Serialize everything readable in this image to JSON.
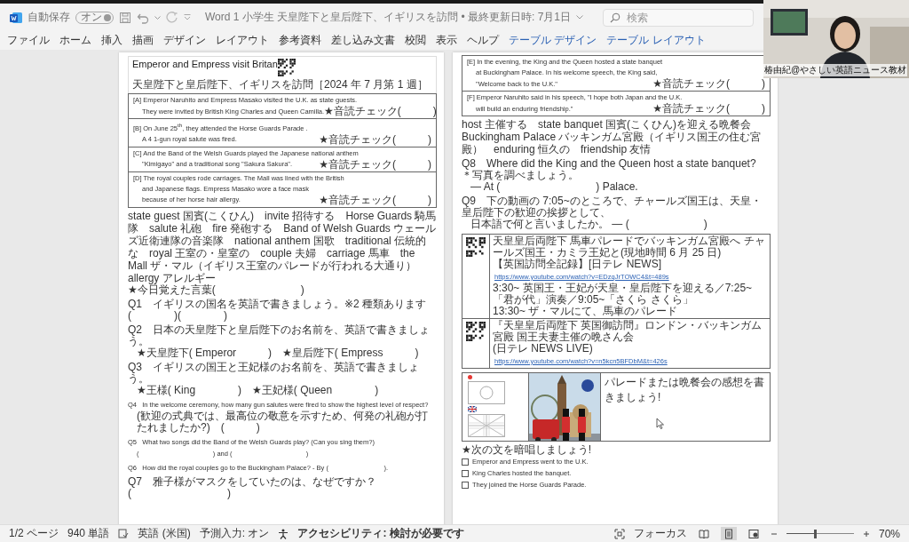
{
  "titlebar": {
    "autosave_label": "自動保存",
    "autosave_toggle": {
      "label": "オン",
      "on": true
    },
    "doc_title": "Word  1  小学生  天皇陛下と皇后陛下、イギリスを訪問 • 最終更新日時: 7月1日",
    "search_placeholder": "検索"
  },
  "ribbon_tabs": [
    {
      "label": "ファイル",
      "contextual": false
    },
    {
      "label": "ホーム",
      "contextual": false
    },
    {
      "label": "挿入",
      "contextual": false
    },
    {
      "label": "描画",
      "contextual": false
    },
    {
      "label": "デザイン",
      "contextual": false
    },
    {
      "label": "レイアウト",
      "contextual": false
    },
    {
      "label": "参考資料",
      "contextual": false
    },
    {
      "label": "差し込み文書",
      "contextual": false
    },
    {
      "label": "校閲",
      "contextual": false
    },
    {
      "label": "表示",
      "contextual": false
    },
    {
      "label": "ヘルプ",
      "contextual": false
    },
    {
      "label": "テーブル デザイン",
      "contextual": true
    },
    {
      "label": "テーブル レイアウト",
      "contextual": true
    }
  ],
  "left_page": {
    "title": "Emperor and Empress visit Britan",
    "subtitle": "天皇陛下と皇后陛下、イギリスを訪問",
    "date": "［2024 年 7 月第 1 週］",
    "passages": [
      {
        "lines": [
          "[A]  Emperor Naruhito and Empress Masako visited the U.K. as state guests.",
          "They were invited by British King Charles and Queen Camilla."
        ],
        "check": "★音読チェック(　　　)"
      },
      {
        "lines": [
          "[B]  On June 25$^{th}$, they attended the Horse Guards Parade .",
          "A 4 1-gun royal salute was fired."
        ],
        "check": "★音読チェック(　　　)"
      },
      {
        "lines": [
          "[C]  And the Band of the Welsh Guards played the Japanese national anthem",
          "\"Kimigayo\" and a traditional song \"Sakura Sakura\"."
        ],
        "check": "★音読チェック(　　　)"
      },
      {
        "lines": [
          "[D]  The royal couples rode carriages.   The Mall was lined with the British",
          "and Japanese flags.   Empress Masako wore a face mask",
          "because of her horse hair allergy."
        ],
        "check": "★音読チェック(　　　)"
      }
    ],
    "vocab": "state guest 国賓(こくひん)　invite 招待する　Horse Guards 騎馬隊　salute 礼砲　fire 発砲する　Band of Welsh Guards ウェールズ近衛連隊の音楽隊　national anthem 国歌　traditional 伝統的な　royal 王室の・皇室の　couple 夫婦　carriage 馬車　the Mall ザ・マル（イギリス王室のパレードが行われる大通り）　allergy アレルギー",
    "vocab_memo": "★今日覚えた言葉(　　　　　　　　)",
    "questions": [
      {
        "lines": [
          "Q1　イギリスの国名を英語で書きましょう。※2 種類あります　(　　　　)(　　　　)"
        ]
      },
      {
        "lines": [
          "Q2　日本の天皇陛下と皇后陛下のお名前を、英語で書きましょう。",
          "★天皇陛下( Emperor　　　)　★皇后陛下( Empress　　　)"
        ]
      },
      {
        "lines": [
          "Q3　イギリスの国王と王妃様のお名前を、英語で書きましょう。",
          "★王様( King　　　　)　★王妃様( Queen　　　　)"
        ]
      },
      {
        "lines": [
          "Q4   In the welcome ceremony, how many gun salutes were fired to show the highest level of respect?",
          "(歓迎の式典では、最高位の敬意を示すため、何発の礼砲が打たれましたか?)　(　　　)"
        ]
      },
      {
        "lines": [
          "Q5   What two songs did the Band of the Welsh Guards play? (Can you sing them?)",
          "(                                        ) and (                                        )"
        ]
      },
      {
        "lines": [
          "Q6   How did the royal couples go to the Buckingham Palace? - By (                              )."
        ]
      },
      {
        "lines": [
          "Q7　雅子様がマスクをしていたのは、なぜですか？(　　　　　　　　　)"
        ]
      }
    ]
  },
  "right_page": {
    "passages": [
      {
        "lines": [
          "[E]  In the evening, the King and the Queen hosted a state banquet",
          "at Buckingham Palace.   In his welcome speech, the King said,",
          "\"Welcome back to the U.K.\""
        ],
        "check": "★音読チェック(　　　)"
      },
      {
        "lines": [
          "[F]  Emperor Naruhito said in his speech, \"I hope both Japan and the U.K.",
          "will build an enduring friendship.\""
        ],
        "check": "★音読チェック(　　　)"
      }
    ],
    "vocab": "host 主催する　state banquet 国賓(こくひん)を迎える晩餐会　Buckingham Palace バッキンガム宮殿（イギリス国王の住む宮殿）　enduring 恒久の　friendship 友情",
    "questions": [
      {
        "lines": [
          "Q8　Where did the King and the Queen host a state banquet?　＊写真を調べましょう。",
          "— At (　　　　　　　　　) Palace."
        ]
      },
      {
        "lines": [
          "Q9　下の動画の 7:05~のところで、チャールズ国王は、天皇・皇后陛下の歓迎の挨拶として、",
          "日本語で何と言いましたか。 — (　　　　　　　)"
        ]
      }
    ],
    "videos": [
      {
        "title": "天皇皇后両陛下 馬車パレードでバッキンガム宮殿へ チャールズ国王・カミラ王妃と(現地時間 6 月 25 日)",
        "source": "【英国訪問全記録】[日テレ NEWS]",
        "link": "https://www.youtube.com/watch?v=EDzqJrTOWC4&t=489s",
        "notes": [
          "3:30~ 英国王・王妃が天皇・皇后陛下を迎える／7:25~「君が代」演奏／9:05~「さくら さくら」",
          "13:30~ ザ・マルにて、馬車のパレード"
        ]
      },
      {
        "title": "『天皇皇后両陛下 英国御訪問』ロンドン・バッキンガム宮殿 国王夫妻主催の晩さん会",
        "source": "(日テレ NEWS LIVE)",
        "link": "https://www.youtube.com/watch?v=n5kcn5BFDbM&t=426s"
      }
    ],
    "impression_prompt": "パレードまたは晩餐会の感想を書きましょう!",
    "memorize_heading": "★次の文を暗唱しましょう!",
    "memorize_items": [
      {
        "text": "Emperor and Empress went to the U.K.",
        "checked": false
      },
      {
        "text": "King Charles hosted the banquet.",
        "checked": false
      },
      {
        "text": "They joined the Horse Guards Parade.",
        "checked": false
      }
    ]
  },
  "webcam": {
    "name": "椿由紀@やさしい英語ニュース教材"
  },
  "status_bar": {
    "page": "1/2 ページ",
    "words": "940 単語",
    "language": "英語 (米国)",
    "predict": "予測入力: オン",
    "accessibility": "アクセシビリティ: 検討が必要です",
    "focus": "フォーカス",
    "views": [
      {
        "kind": "read",
        "selected": false
      },
      {
        "kind": "print",
        "selected": true
      },
      {
        "kind": "web",
        "selected": false
      }
    ],
    "zoom": {
      "level": 0.42
    },
    "zoom_text": "70%"
  }
}
